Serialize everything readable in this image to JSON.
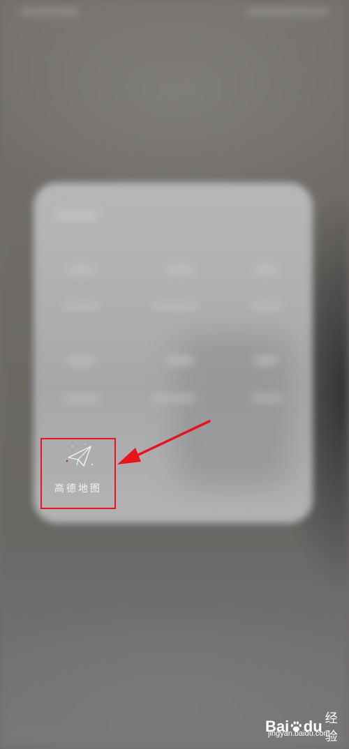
{
  "gaode_tile": {
    "label": "高德地图",
    "icon": "paper-plane-icon",
    "highlight_color": "#e8141c"
  },
  "annotation": {
    "color": "#e8141c",
    "points_to": "gaode_tile"
  },
  "watermark": {
    "brand_left": "Bai",
    "brand_right": "du",
    "brand_cn": "经验",
    "url": "jingyan.baidu.com",
    "icon": "baidu-paw-icon"
  },
  "colors": {
    "backdrop": "#6f6c69",
    "card": "#b0b1b2",
    "label_text": "#f4f4f4"
  }
}
